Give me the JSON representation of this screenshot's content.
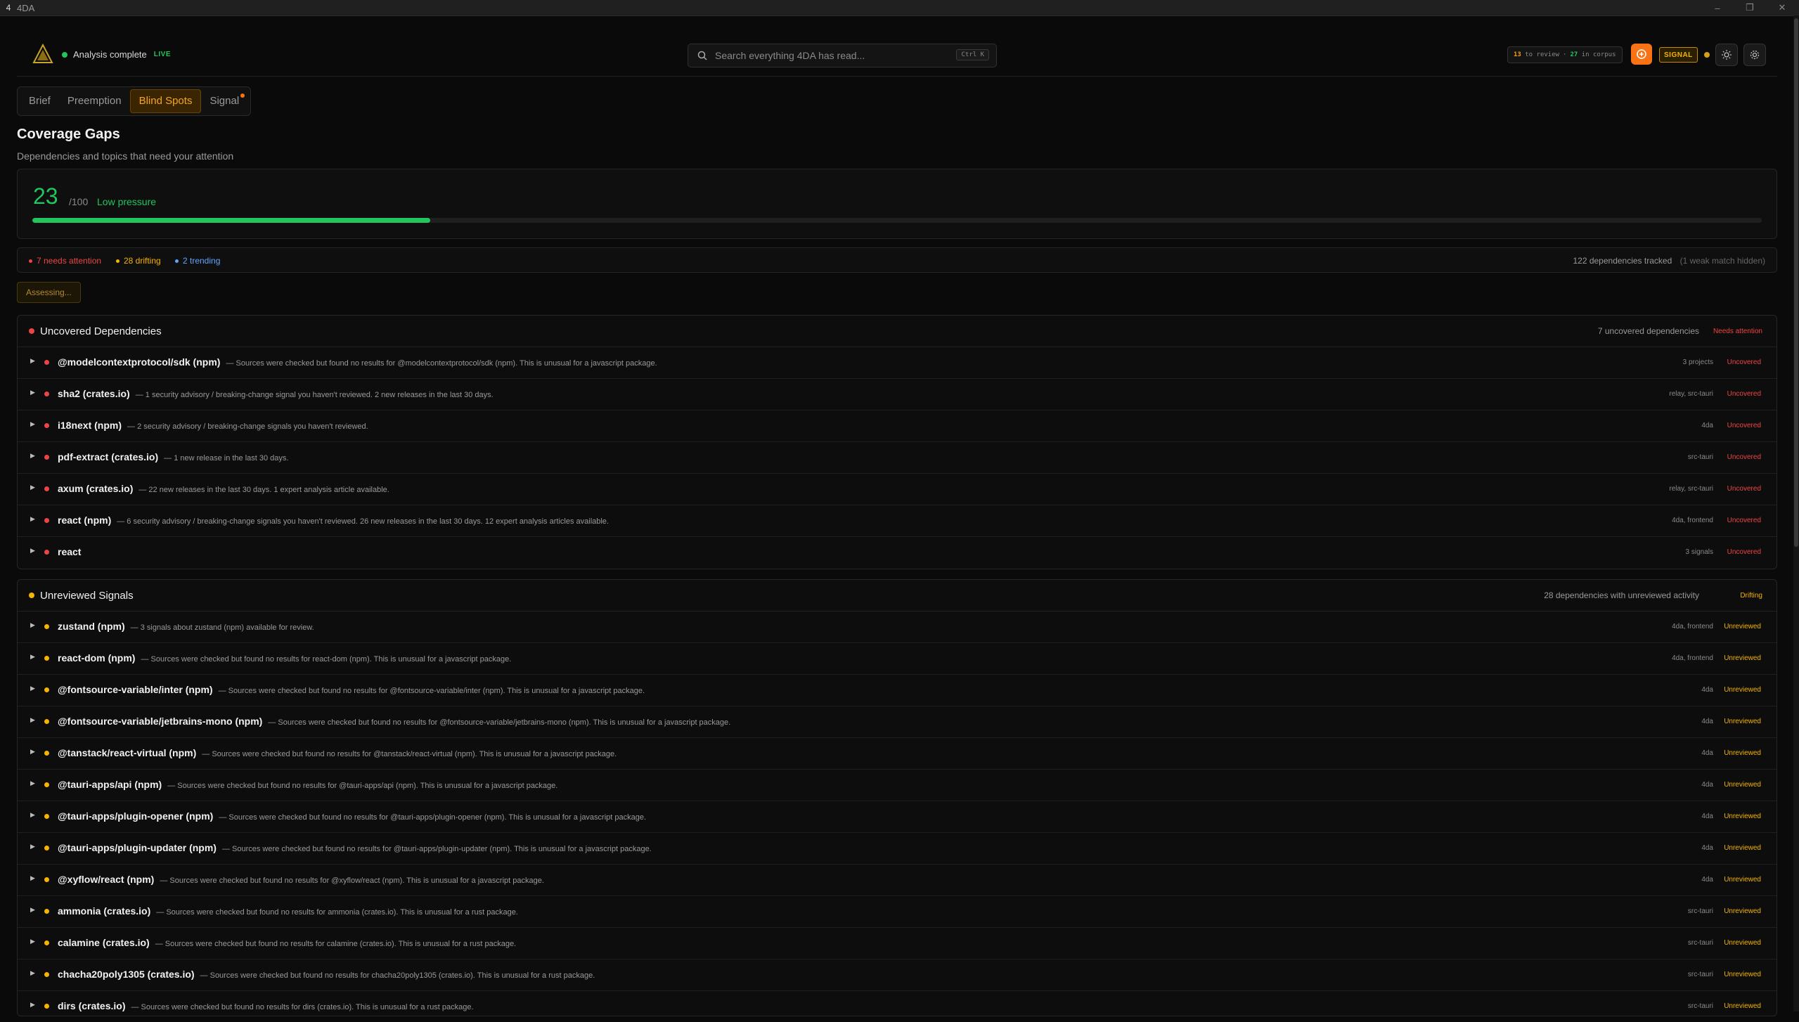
{
  "window": {
    "app_glyph": "4",
    "title": "4DA",
    "minimize": "–",
    "maximize": "❐",
    "close": "✕"
  },
  "header": {
    "status_text": "Analysis complete",
    "live_label": "LIVE",
    "search_placeholder": "Search everything 4DA has read...",
    "search_shortcut": "Ctrl K",
    "review_count": "13",
    "review_label": "to review",
    "review_sep": "·",
    "corpus_count": "27",
    "corpus_label": "in corpus",
    "signal_badge": "SIGNAL"
  },
  "tabs": [
    {
      "label": "Brief",
      "active": false
    },
    {
      "label": "Preemption",
      "active": false
    },
    {
      "label": "Blind Spots",
      "active": true
    },
    {
      "label": "Signal",
      "active": false,
      "notification": true
    }
  ],
  "page": {
    "title": "Coverage Gaps",
    "subtitle": "Dependencies and topics that need your attention"
  },
  "score": {
    "value": "23",
    "max": "/100",
    "label": "Low pressure",
    "fraction": 0.23
  },
  "summary": {
    "needs_attention": "7 needs attention",
    "drifting": "28 drifting",
    "trending": "2 trending",
    "tracked": "122 dependencies tracked",
    "hidden": "(1 weak match hidden)"
  },
  "assess_button": "Assessing...",
  "sections": {
    "uncovered": {
      "title": "Uncovered Dependencies",
      "meta": "7 uncovered dependencies",
      "flag": "Needs attention",
      "rows": [
        {
          "name": "@modelcontextprotocol/sdk (npm)",
          "desc": "— Sources were checked but found no results for @modelcontextprotocol/sdk (npm). This is unusual for a javascript package.",
          "projects": "3 projects",
          "status": "Uncovered"
        },
        {
          "name": "sha2 (crates.io)",
          "desc": "— 1 security advisory / breaking-change signal you haven't reviewed. 2 new releases in the last 30 days.",
          "projects": "relay, src-tauri",
          "status": "Uncovered"
        },
        {
          "name": "i18next (npm)",
          "desc": "— 2 security advisory / breaking-change signals you haven't reviewed.",
          "projects": "4da",
          "status": "Uncovered"
        },
        {
          "name": "pdf-extract (crates.io)",
          "desc": "— 1 new release in the last 30 days.",
          "projects": "src-tauri",
          "status": "Uncovered"
        },
        {
          "name": "axum (crates.io)",
          "desc": "— 22 new releases in the last 30 days. 1 expert analysis article available.",
          "projects": "relay, src-tauri",
          "status": "Uncovered"
        },
        {
          "name": "react (npm)",
          "desc": "— 6 security advisory / breaking-change signals you haven't reviewed. 26 new releases in the last 30 days. 12 expert analysis articles available.",
          "projects": "4da, frontend",
          "status": "Uncovered"
        },
        {
          "name": "react",
          "desc": "",
          "projects": "3 signals",
          "status": "Uncovered"
        }
      ]
    },
    "unreviewed": {
      "title": "Unreviewed Signals",
      "meta": "28 dependencies with unreviewed activity",
      "flag": "Drifting",
      "rows": [
        {
          "name": "zustand (npm)",
          "desc": "— 3 signals about zustand (npm) available for review.",
          "projects": "4da, frontend",
          "status": "Unreviewed"
        },
        {
          "name": "react-dom (npm)",
          "desc": "— Sources were checked but found no results for react-dom (npm). This is unusual for a javascript package.",
          "projects": "4da, frontend",
          "status": "Unreviewed"
        },
        {
          "name": "@fontsource-variable/inter (npm)",
          "desc": "— Sources were checked but found no results for @fontsource-variable/inter (npm). This is unusual for a javascript package.",
          "projects": "4da",
          "status": "Unreviewed"
        },
        {
          "name": "@fontsource-variable/jetbrains-mono (npm)",
          "desc": "— Sources were checked but found no results for @fontsource-variable/jetbrains-mono (npm). This is unusual for a javascript package.",
          "projects": "4da",
          "status": "Unreviewed"
        },
        {
          "name": "@tanstack/react-virtual (npm)",
          "desc": "— Sources were checked but found no results for @tanstack/react-virtual (npm). This is unusual for a javascript package.",
          "projects": "4da",
          "status": "Unreviewed"
        },
        {
          "name": "@tauri-apps/api (npm)",
          "desc": "— Sources were checked but found no results for @tauri-apps/api (npm). This is unusual for a javascript package.",
          "projects": "4da",
          "status": "Unreviewed"
        },
        {
          "name": "@tauri-apps/plugin-opener (npm)",
          "desc": "— Sources were checked but found no results for @tauri-apps/plugin-opener (npm). This is unusual for a javascript package.",
          "projects": "4da",
          "status": "Unreviewed"
        },
        {
          "name": "@tauri-apps/plugin-updater (npm)",
          "desc": "— Sources were checked but found no results for @tauri-apps/plugin-updater (npm). This is unusual for a javascript package.",
          "projects": "4da",
          "status": "Unreviewed"
        },
        {
          "name": "@xyflow/react (npm)",
          "desc": "— Sources were checked but found no results for @xyflow/react (npm). This is unusual for a javascript package.",
          "projects": "4da",
          "status": "Unreviewed"
        },
        {
          "name": "ammonia (crates.io)",
          "desc": "— Sources were checked but found no results for ammonia (crates.io). This is unusual for a rust package.",
          "projects": "src-tauri",
          "status": "Unreviewed"
        },
        {
          "name": "calamine (crates.io)",
          "desc": "— Sources were checked but found no results for calamine (crates.io). This is unusual for a rust package.",
          "projects": "src-tauri",
          "status": "Unreviewed"
        },
        {
          "name": "chacha20poly1305 (crates.io)",
          "desc": "— Sources were checked but found no results for chacha20poly1305 (crates.io). This is unusual for a rust package.",
          "projects": "src-tauri",
          "status": "Unreviewed"
        },
        {
          "name": "dirs (crates.io)",
          "desc": "— Sources were checked but found no results for dirs (crates.io). This is unusual for a rust package.",
          "projects": "src-tauri",
          "status": "Unreviewed"
        }
      ]
    }
  },
  "colors": {
    "accent_orange": "#f97316",
    "tab_active": "#f5a623",
    "success_green": "#22c55e",
    "danger_red": "#ef4444",
    "warning_amber": "#f5b400",
    "info_blue": "#60a5fa"
  },
  "icons": {
    "logo": "triangle-logo-icon",
    "search": "search-icon",
    "orange_button": "target-icon",
    "theme": "sun-icon",
    "settings": "gear-icon",
    "expand": "chevron-right-icon"
  }
}
